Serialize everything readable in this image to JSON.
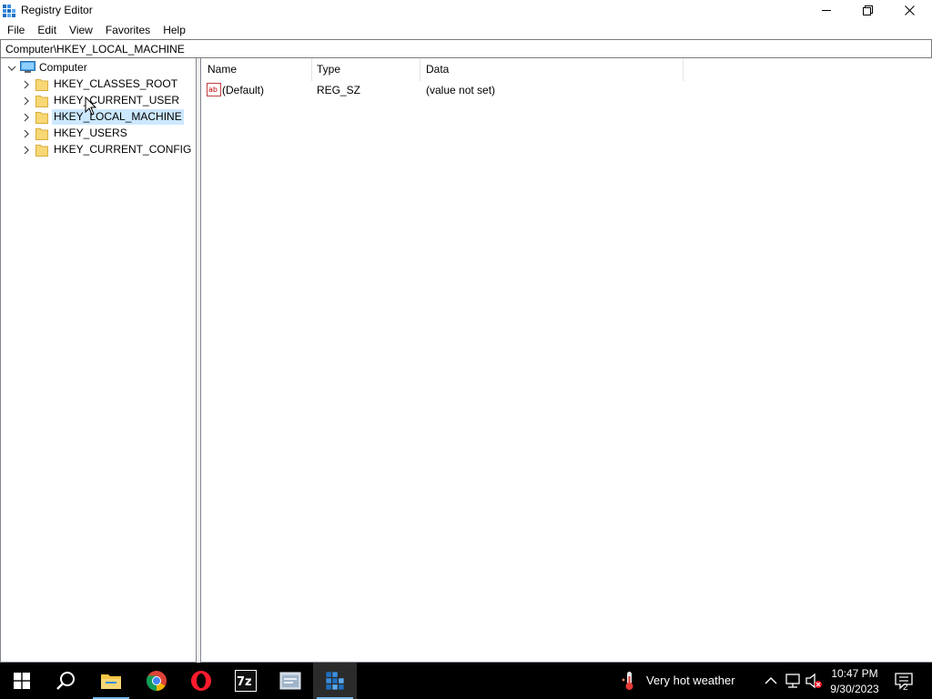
{
  "window": {
    "title": "Registry Editor",
    "app_icon": "registry-editor-icon"
  },
  "controls": {
    "minimize": "minimize-icon",
    "restore": "restore-icon",
    "close": "close-icon"
  },
  "menu": {
    "items": [
      {
        "label": "File"
      },
      {
        "label": "Edit"
      },
      {
        "label": "View"
      },
      {
        "label": "Favorites"
      },
      {
        "label": "Help"
      }
    ]
  },
  "address": {
    "path": "Computer\\HKEY_LOCAL_MACHINE"
  },
  "tree": {
    "root": {
      "label": "Computer",
      "icon": "computer-icon",
      "expanded": true
    },
    "children": [
      {
        "label": "HKEY_CLASSES_ROOT",
        "selected": false
      },
      {
        "label": "HKEY_CURRENT_USER",
        "selected": false
      },
      {
        "label": "HKEY_LOCAL_MACHINE",
        "selected": true
      },
      {
        "label": "HKEY_USERS",
        "selected": false
      },
      {
        "label": "HKEY_CURRENT_CONFIG",
        "selected": false
      }
    ]
  },
  "list": {
    "columns": [
      {
        "label": "Name"
      },
      {
        "label": "Type"
      },
      {
        "label": "Data"
      }
    ],
    "rows": [
      {
        "name": "(Default)",
        "type": "REG_SZ",
        "data": "(value not set)",
        "icon": "string-value-icon"
      }
    ]
  },
  "taskbar": {
    "apps": [
      {
        "name": "start-button"
      },
      {
        "name": "search-button"
      },
      {
        "name": "file-explorer",
        "running": true
      },
      {
        "name": "chrome"
      },
      {
        "name": "opera"
      },
      {
        "name": "7zip"
      },
      {
        "name": "registry-tool"
      },
      {
        "name": "registry-editor",
        "active": true
      }
    ],
    "weather": {
      "text": "Very hot weather",
      "icon": "thermometer-icon"
    },
    "clock": {
      "time": "10:47 PM",
      "date": "9/30/2023"
    },
    "notifications": {
      "count": "2"
    },
    "colors": {
      "accent": "#76b9ed",
      "selection": "#cce8ff"
    }
  }
}
